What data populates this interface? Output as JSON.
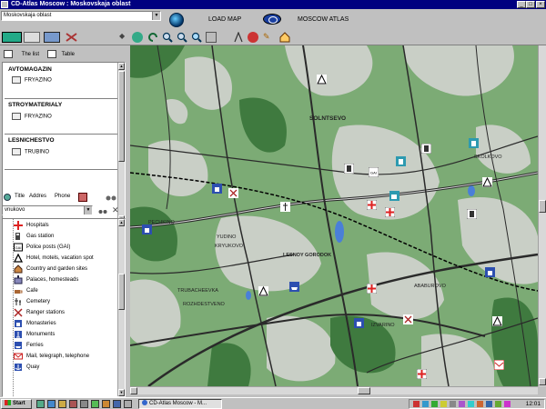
{
  "window": {
    "title": "CD-Atlas Moscow : Moskovskaja oblast"
  },
  "topbar": {
    "region_value": "Moskovskaja oblast",
    "load_map_label": "LOAD MAP",
    "moscow_atlas_label": "MOSCOW ATLAS"
  },
  "left": {
    "tabs": {
      "list_label": "The list",
      "table_label": "Table"
    },
    "groups": [
      {
        "title": "AVTOMAGAZIN",
        "item": "FRYAZINO"
      },
      {
        "title": "STROYMATERIALY",
        "item": "FRYAZINO"
      },
      {
        "title": "LESNICHESTVO",
        "item": "TRUBINO"
      }
    ],
    "search_tabs": {
      "title": "Title",
      "address": "Addres",
      "phone": "Phone"
    },
    "search_value": "vnukovo",
    "legend": [
      "Hospitals",
      "Gas station",
      "Police posts (GAI)",
      "Hotel, motels, vacation spot",
      "Country and garden sites",
      "Palaces, homesteads",
      "Cafe",
      "Cemetery",
      "Ranger stations",
      "Monasteries",
      "Monuments",
      "Ferries",
      "Mail, telegraph, telephone",
      "Quay"
    ]
  },
  "map": {
    "labels": [
      "SOLNTSEVO",
      "YUDINO",
      "KRYUKOVO",
      "LESNOY GORODOK",
      "SKOLKOVO",
      "ABABUROVO",
      "IZVARINO",
      "TRUBACHEEVKA",
      "ROZHDESTVENO",
      "PECHKINO"
    ]
  },
  "taskbar": {
    "start_label": "Start",
    "task_label": "CD-Atlas Moscow - M...",
    "clock": "12:01"
  },
  "colors": {
    "titlebar": "#000080",
    "forest": "#3f7a3f",
    "field": "#c9cfc6",
    "road": "#2a2a2a"
  }
}
